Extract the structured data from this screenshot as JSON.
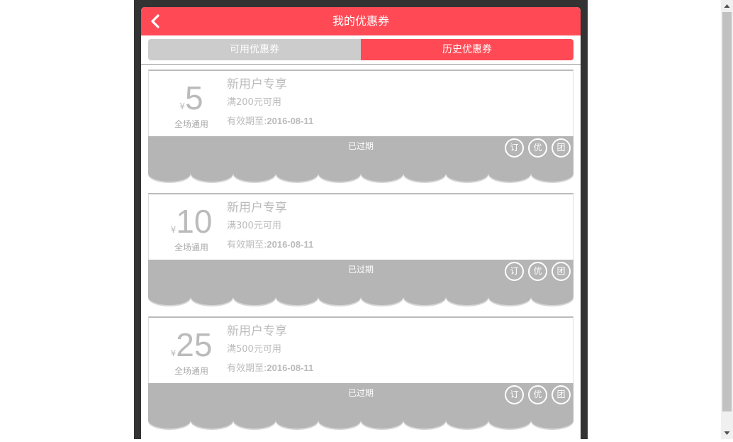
{
  "header": {
    "title": "我的优惠券",
    "back_icon": "chevron-left-icon"
  },
  "tabs": [
    {
      "label": "可用优惠券",
      "active": false
    },
    {
      "label": "历史优惠券",
      "active": true
    }
  ],
  "colors": {
    "accent": "#ff4a55",
    "expired_gray": "#b5b5b5",
    "tab_inactive": "#cccccc"
  },
  "coupons": [
    {
      "currency": "¥",
      "amount": "5",
      "scope": "全场通用",
      "title": "新用户专享",
      "condition": "满200元可用",
      "validity_prefix": "有效期至:",
      "validity_date": "2016-08-11",
      "status": "已过期",
      "badges": [
        "订",
        "优",
        "团"
      ]
    },
    {
      "currency": "¥",
      "amount": "10",
      "scope": "全场通用",
      "title": "新用户专享",
      "condition": "满300元可用",
      "validity_prefix": "有效期至:",
      "validity_date": "2016-08-11",
      "status": "已过期",
      "badges": [
        "订",
        "优",
        "团"
      ]
    },
    {
      "currency": "¥",
      "amount": "25",
      "scope": "全场通用",
      "title": "新用户专享",
      "condition": "满500元可用",
      "validity_prefix": "有效期至:",
      "validity_date": "2016-08-11",
      "status": "已过期",
      "badges": [
        "订",
        "优",
        "团"
      ]
    }
  ]
}
